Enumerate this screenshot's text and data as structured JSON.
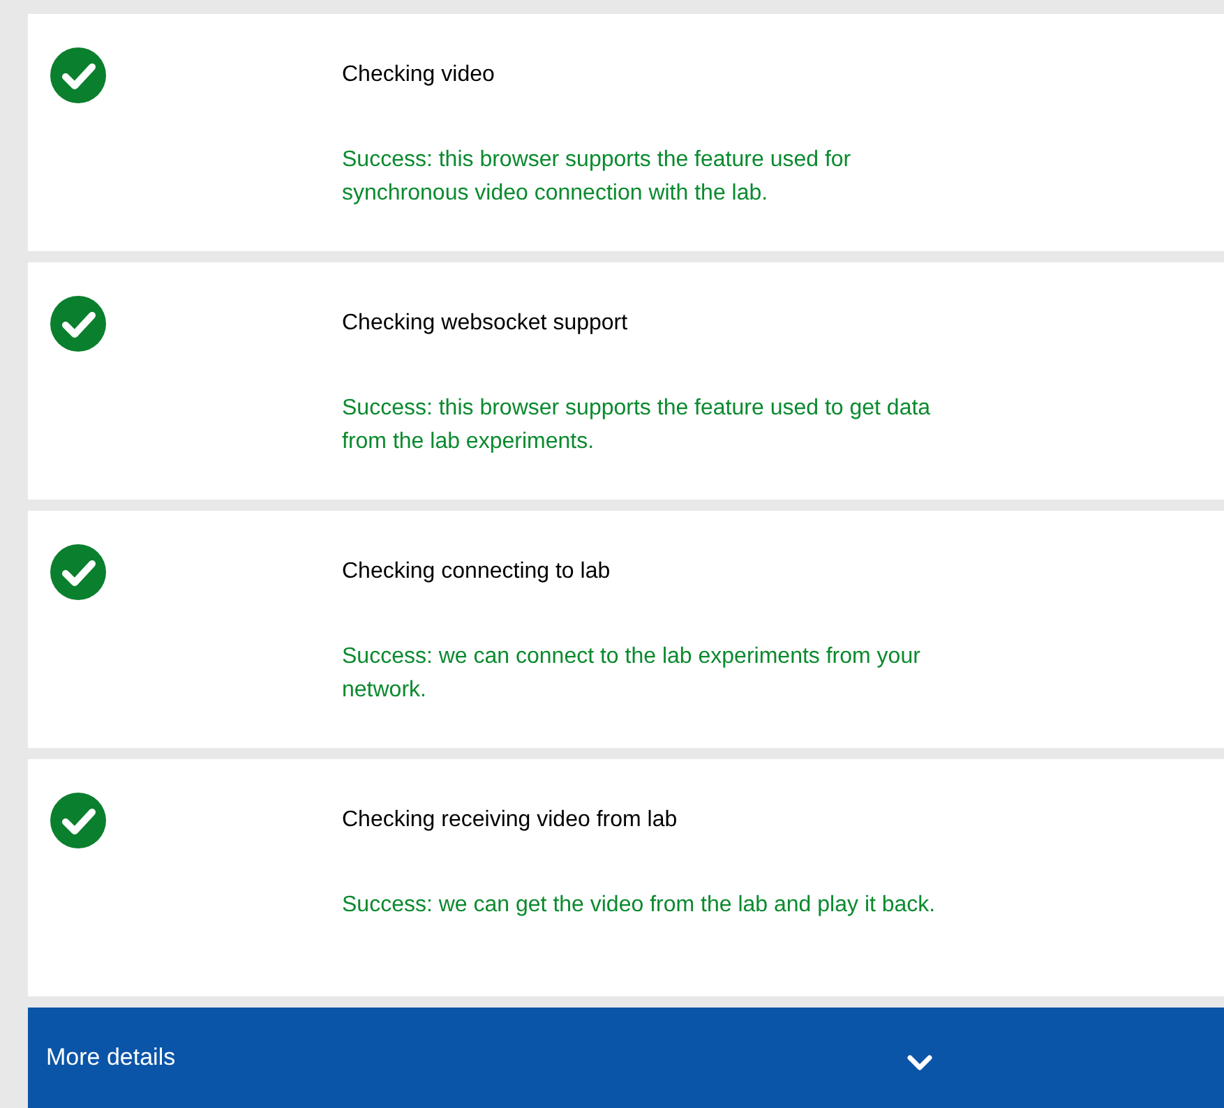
{
  "checks": [
    {
      "title": "Checking video",
      "passed": true,
      "message": "Success: this browser supports the feature used for synchronous video connection with the lab."
    },
    {
      "title": "Checking websocket support",
      "passed": true,
      "message": "Success: this browser supports the feature used to get data from the lab experiments."
    },
    {
      "title": "Checking connecting to lab",
      "passed": true,
      "message": "Success: we can connect to the lab experiments from your network."
    },
    {
      "title": "Checking receiving video from lab",
      "passed": true,
      "message": "Success: we can get the video from the lab and play it back."
    }
  ],
  "details": {
    "label": "More details",
    "expanded": false
  }
}
